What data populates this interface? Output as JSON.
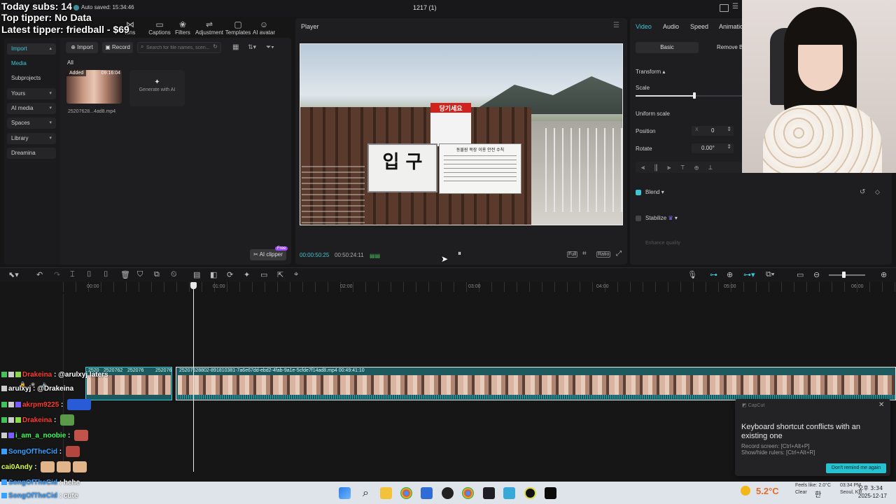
{
  "overlay": {
    "today_subs": "Today subs: 14",
    "top_tipper": "Top tipper: No Data",
    "latest_tipper": "Latest tipper: friedball - $69"
  },
  "window": {
    "autosave": "Auto saved: 15:34:46",
    "title": "1217 (1)"
  },
  "toolbar": {
    "items": [
      {
        "label": "ions",
        "icon": "transitions-icon"
      },
      {
        "label": "Captions",
        "icon": "captions-icon"
      },
      {
        "label": "Filters",
        "icon": "filters-icon"
      },
      {
        "label": "Adjustment",
        "icon": "adjustment-icon"
      },
      {
        "label": "Templates",
        "icon": "templates-icon"
      },
      {
        "label": "AI avatar",
        "icon": "ai-avatar-icon"
      }
    ]
  },
  "left_nav": {
    "import_label": "Import",
    "media_label": "Media",
    "subprojects_label": "Subprojects",
    "yours_label": "Yours",
    "ai_media_label": "AI media",
    "spaces_label": "Spaces",
    "library_label": "Library",
    "dreamina_label": "Dreamina"
  },
  "media": {
    "import_button": "Import",
    "record_button": "Record",
    "search_placeholder": "Search for file names, scen...",
    "filter_all": "All",
    "clip_badge": "Added",
    "clip_duration": "09:16:04",
    "clip_name": "25207628...4ad8.mp4",
    "generate_label": "Generate with AI",
    "ai_clipper": "AI clipper",
    "free_badge": "Free"
  },
  "player": {
    "title": "Player",
    "current_time": "00:00:50:25",
    "total_time": "00:50:24:11",
    "full_label": "Full",
    "ratio_label": "Ratio",
    "sign_main": "입 구",
    "sign_right": "동물원 목장 이용 안전 수칙",
    "sign_red": "당기세요"
  },
  "properties": {
    "tabs": [
      "Video",
      "Audio",
      "Speed",
      "Animatio"
    ],
    "basic_tab": "Basic",
    "remove_bg_tab": "Remove BG",
    "transform_label": "Transform",
    "scale_label": "Scale",
    "scale_value": 0.55,
    "uniform_scale_label": "Uniform scale",
    "position_label": "Position",
    "position_x_label": "X",
    "position_x_value": "0",
    "rotate_label": "Rotate",
    "rotate_value": "0.00°",
    "blend_label": "Blend",
    "stabilize_label": "Stabilize",
    "enhance_label": "Enhance quality"
  },
  "timeline": {
    "ruler": [
      "00:00",
      "01:00",
      "02:00",
      "03:00",
      "04:00",
      "05:00",
      "06:00"
    ],
    "clip_small_labels": [
      "2520",
      "2520762",
      "252076",
      "252076"
    ],
    "main_clip_label": "25207628802-891810381-7a6e67dd-ebd2-4fab-9a1e-5cfde7f14ad8.mp4   00:49:41:10"
  },
  "chat": [
    {
      "user": "Drakeina",
      "message": "@arulxyj laters",
      "color": "#ff3b30"
    },
    {
      "user": "arulxyj",
      "message": "@Drakeina",
      "color": "#ffffff"
    },
    {
      "user": "akrpm9225",
      "message": "",
      "color": "#ff3b30"
    },
    {
      "user": "Drakeina",
      "message": "",
      "color": "#ff3b30"
    },
    {
      "user": "i_am_a_noobie",
      "message": "",
      "color": "#3cff5a"
    },
    {
      "user": "SongOfTheCid",
      "message": "",
      "color": "#3aa0ff"
    },
    {
      "user": "cai0Andy",
      "message": "",
      "color": "#d7ff4a"
    },
    {
      "user": "SongOfTheCid",
      "message": "hehe",
      "color": "#3aa0ff"
    },
    {
      "user": "SongOfTheCid",
      "message": "cute",
      "color": "#3aa0ff"
    }
  ],
  "notification": {
    "app": "CapCut",
    "title": "Keyboard shortcut conflicts with an existing one",
    "line1": "Record screen: [Ctrl+Alt+P]",
    "line2": "Show/hide rulers: [Ctrl+Alt+R]",
    "button": "Don't remind me again"
  },
  "taskbar": {
    "weather_temp": "5.2°C",
    "weather_feels": "Feels like: 2.0°C",
    "weather_desc": "Clear",
    "weather_time": "03:34 PM",
    "weather_loc": "Seoul, KR",
    "lang": "한",
    "time": "오후 3:34",
    "date": "2025-12-17"
  }
}
